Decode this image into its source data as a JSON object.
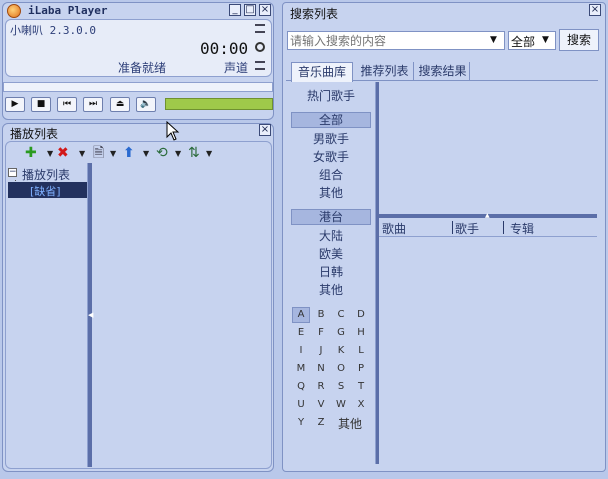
{
  "player": {
    "title": "iLaba Player",
    "version": "小喇叭 2.3.0.0",
    "time": "00:00",
    "status": "准备就绪",
    "channel": "声道"
  },
  "playlist": {
    "title": "播放列表",
    "root": "播放列表",
    "child": "[缺省]"
  },
  "search": {
    "title": "搜索列表",
    "placeholder": "请输入搜索的内容",
    "scope": "全部",
    "button": "搜索",
    "tabs": [
      "音乐曲库",
      "推荐列表",
      "搜索结果"
    ],
    "hot": "热门歌手",
    "group1_header": "全部",
    "group1": [
      "男歌手",
      "女歌手",
      "组合",
      "其他"
    ],
    "group2_header": "港台",
    "group2": [
      "大陆",
      "欧美",
      "日韩",
      "其他"
    ],
    "letters": [
      "A",
      "B",
      "C",
      "D",
      "E",
      "F",
      "G",
      "H",
      "I",
      "J",
      "K",
      "L",
      "M",
      "N",
      "O",
      "P",
      "Q",
      "R",
      "S",
      "T",
      "U",
      "V",
      "W",
      "X",
      "Y",
      "Z",
      "其他"
    ],
    "columns": [
      "歌曲",
      "歌手",
      "专辑"
    ]
  },
  "colors": {
    "background": "#b9c8ea",
    "panel": "#c7d3ef",
    "volume": "#9fc94a",
    "selection": "#23315e"
  }
}
